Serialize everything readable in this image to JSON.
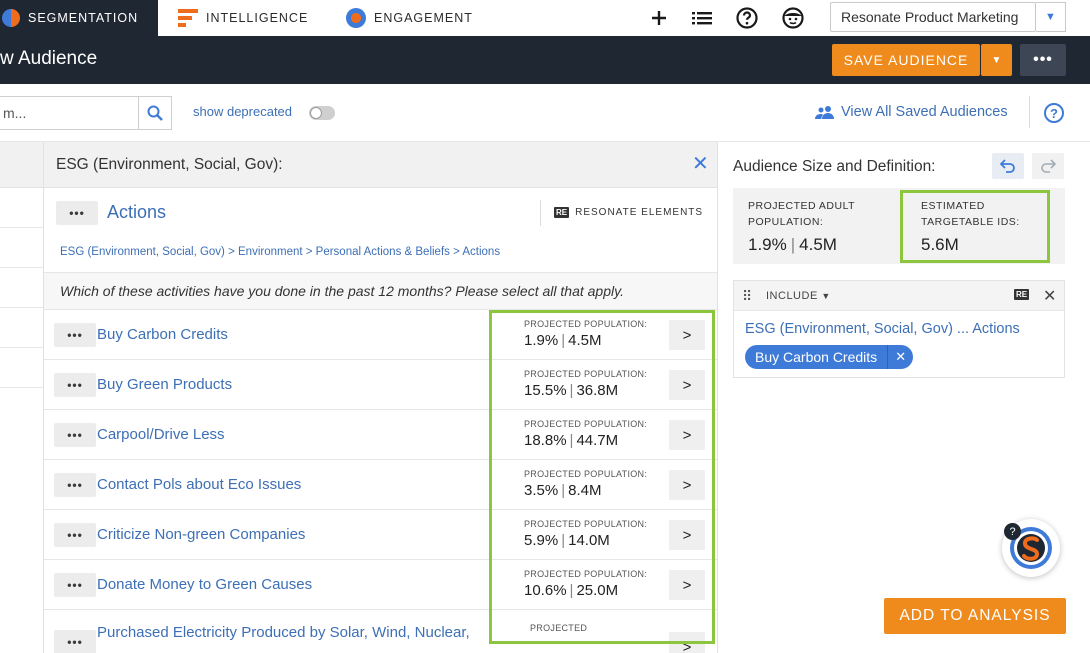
{
  "topnav": {
    "tabs": [
      {
        "label": "SEGMENTATION"
      },
      {
        "label": "INTELLIGENCE"
      },
      {
        "label": "ENGAGEMENT"
      }
    ],
    "workspace": "Resonate Product Marketing"
  },
  "header": {
    "title": "w Audience",
    "save_label": "SAVE AUDIENCE",
    "more_label": "•••"
  },
  "toolbar": {
    "search_value": "m...",
    "show_deprecated": "show deprecated",
    "view_all": "View All Saved Audiences"
  },
  "panel": {
    "title": "ESG (Environment, Social, Gov):",
    "section_title": "Actions",
    "re_elements": "RESONATE ELEMENTS",
    "breadcrumb": "ESG (Environment, Social, Gov) > Environment > Personal Actions & Beliefs > Actions",
    "question": "Which of these activities have you done in the past 12 months? Please select all that apply.",
    "pop_label": "PROJECTED POPULATION:",
    "options": [
      {
        "label": "Buy Carbon Credits",
        "pct": "1.9%",
        "count": "4.5M"
      },
      {
        "label": "Buy Green Products",
        "pct": "15.5%",
        "count": "36.8M"
      },
      {
        "label": "Carpool/Drive Less",
        "pct": "18.8%",
        "count": "44.7M"
      },
      {
        "label": "Contact Pols about Eco Issues",
        "pct": "3.5%",
        "count": "8.4M"
      },
      {
        "label": "Criticize Non-green Companies",
        "pct": "5.9%",
        "count": "14.0M"
      },
      {
        "label": "Donate Money to Green Causes",
        "pct": "10.6%",
        "count": "25.0M"
      },
      {
        "label": "Purchased Electricity Produced by Solar, Wind, Nuclear,",
        "pct": "",
        "count": ""
      }
    ],
    "last_pop_label": "PROJECTED"
  },
  "right": {
    "title": "Audience Size and Definition:",
    "projected_label_1": "PROJECTED ADULT",
    "projected_label_2": "POPULATION:",
    "projected_pct": "1.9%",
    "projected_count": "4.5M",
    "estimated_label_1": "ESTIMATED",
    "estimated_label_2": "TARGETABLE IDS:",
    "estimated_value": "5.6M",
    "include_label": "INCLUDE",
    "definition_path": "ESG (Environment, Social, Gov) ... Actions",
    "chip_label": "Buy Carbon Credits",
    "add_label": "ADD TO ANALYSIS"
  },
  "colors": {
    "nav_dark": "#1f2733",
    "accent_orange": "#ef8a1d",
    "link_blue": "#3d6fb5",
    "highlight_green": "#8cc63f"
  },
  "icons": [
    "plus-icon",
    "list-icon",
    "help-icon",
    "user-face-icon",
    "search-icon",
    "users-icon",
    "close-icon",
    "undo-icon",
    "redo-icon",
    "drag-handle-icon",
    "chevron-right-icon",
    "chevron-down-icon"
  ]
}
